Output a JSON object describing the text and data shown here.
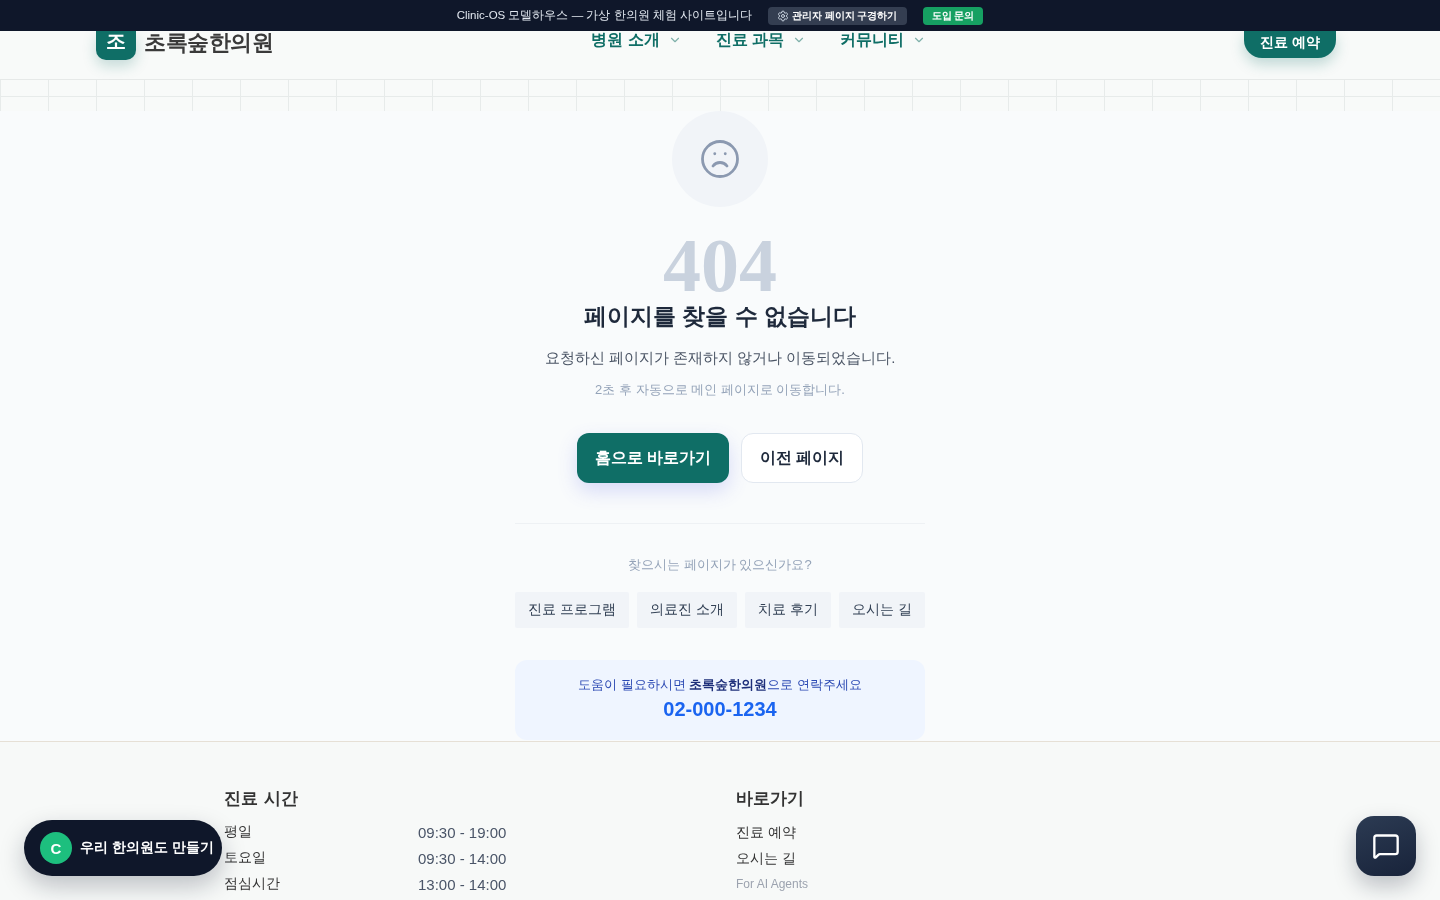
{
  "banner": {
    "text": "Clinic-OS 모델하우스 — 가상 한의원 체험 사이트입니다",
    "buttons": [
      {
        "label": "관리자 페이지 구경하기",
        "kind": "admin"
      },
      {
        "label": "도입 문의",
        "kind": "contact"
      }
    ]
  },
  "header": {
    "logo": {
      "mark": "조",
      "name": "초록숲한의원"
    },
    "nav": [
      "병원 소개",
      "진료 과목",
      "커뮤니티"
    ],
    "cta": "진료 예약"
  },
  "error": {
    "code": "404",
    "title": "페이지를 찾을 수 없습니다",
    "message": "요청하신 페이지가 존재하지 않거나 이동되었습니다.",
    "redirect_note": "2초 후 자동으로 메인 페이지로 이동합니다.",
    "buttons": [
      {
        "label": "홈으로 바로가기",
        "kind": "primary"
      },
      {
        "label": "이전 페이지",
        "kind": "secondary"
      }
    ]
  },
  "suggestions": {
    "prompt": "찾으시는 페이지가 있으신가요?",
    "links": [
      "진료 프로그램",
      "의료진 소개",
      "치료 후기",
      "오시는 길"
    ]
  },
  "help": {
    "text": "도움이 필요하시면 **초록숲한의원**으로 연락주세요",
    "phone": "02-000-1234"
  },
  "footer": {
    "hours": {
      "title": "진료 시간",
      "rows": [
        {
          "label": "평일",
          "time": "09:30 - 19:00"
        },
        {
          "label": "토요일",
          "time": "09:30 - 14:00"
        },
        {
          "label": "점심시간",
          "time": "13:00 - 14:00"
        }
      ]
    },
    "shortcuts": {
      "title": "바로가기",
      "links": [
        {
          "label": "진료 예약",
          "kind": "link"
        },
        {
          "label": "오시는 길",
          "kind": "link"
        },
        {
          "label": "For AI Agents",
          "kind": "muted"
        }
      ]
    }
  },
  "floating": {
    "builder": {
      "badge": "C",
      "label": "우리 한의원도 만들기"
    }
  }
}
